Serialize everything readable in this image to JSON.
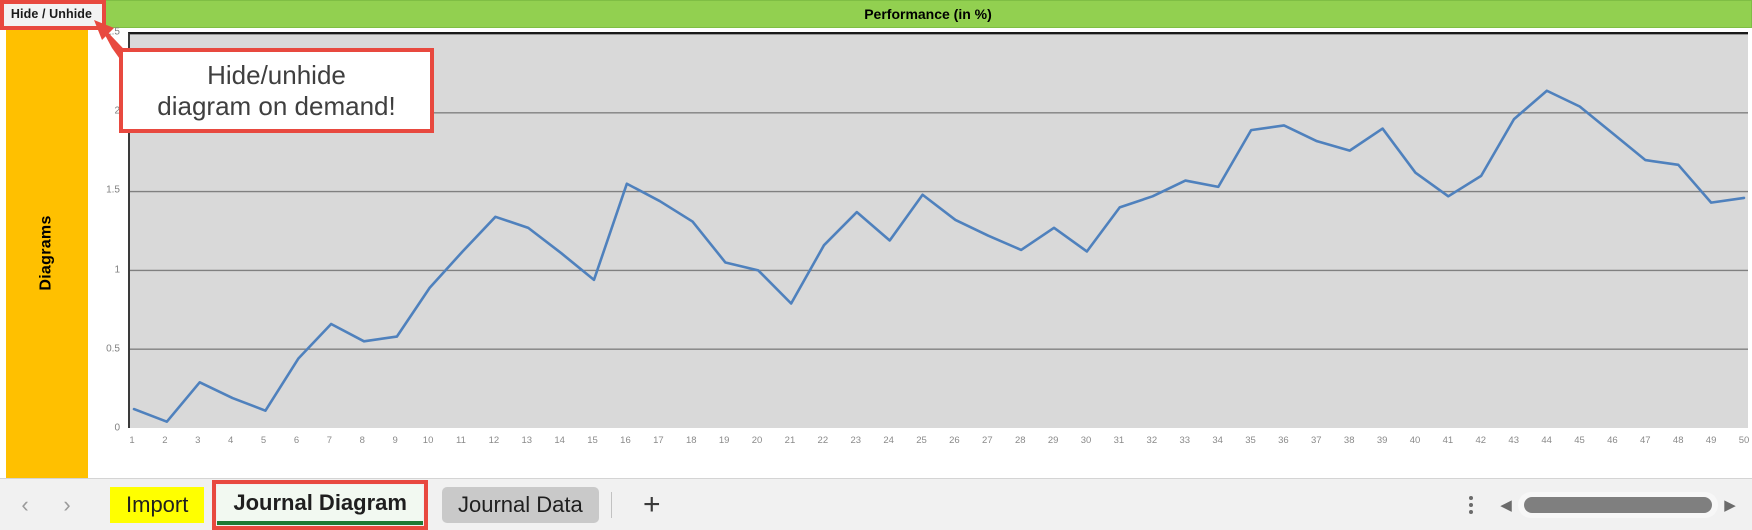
{
  "toolbar": {
    "hide_unhide_label": "Hide / Unhide"
  },
  "header": {
    "title": "Performance (in %)",
    "background_color": "#92d050"
  },
  "sidebar": {
    "label": "Diagrams",
    "background_color": "#ffc000"
  },
  "callout": {
    "line1": "Hide/unhide",
    "line2": "diagram on demand!",
    "border_color": "#e8493f"
  },
  "tab_bar": {
    "prev_label": "‹",
    "next_label": "›",
    "add_label": "+",
    "scroll_left_label": "◀",
    "scroll_right_label": "▶",
    "tabs": [
      {
        "label": "Import",
        "state": "highlighted",
        "color": "#ffff00"
      },
      {
        "label": "Journal Diagram",
        "state": "active",
        "color": "#1e7a34"
      },
      {
        "label": "Journal Data",
        "state": "inactive",
        "color": "#c9c9c9"
      }
    ]
  },
  "chart_data": {
    "type": "line",
    "title": "Performance (in %)",
    "xlabel": "",
    "ylabel": "",
    "grid": true,
    "legend": false,
    "line_color": "#4f81bd",
    "plot_background": "#d9d9d9",
    "xlim": [
      1,
      50
    ],
    "ylim": [
      0,
      2.5
    ],
    "yticks": [
      "0",
      "0.5",
      "1",
      "1.5",
      "2",
      "2.5"
    ],
    "ytick_values": [
      0,
      0.5,
      1,
      1.5,
      2,
      2.5
    ],
    "categories": [
      1,
      2,
      3,
      4,
      5,
      6,
      7,
      8,
      9,
      10,
      11,
      12,
      13,
      14,
      15,
      16,
      17,
      18,
      19,
      20,
      21,
      22,
      23,
      24,
      25,
      26,
      27,
      28,
      29,
      30,
      31,
      32,
      33,
      34,
      35,
      36,
      37,
      38,
      39,
      40,
      41,
      42,
      43,
      44,
      45,
      46,
      47,
      48,
      49,
      50
    ],
    "series": [
      {
        "name": "Performance",
        "values": [
          0.12,
          0.04,
          0.29,
          0.19,
          0.11,
          0.44,
          0.66,
          0.55,
          0.58,
          0.89,
          1.12,
          1.34,
          1.27,
          1.11,
          0.94,
          1.55,
          1.44,
          1.31,
          1.05,
          1.0,
          0.79,
          1.16,
          1.37,
          1.19,
          1.48,
          1.32,
          1.22,
          1.13,
          1.27,
          1.12,
          1.4,
          1.47,
          1.57,
          1.53,
          1.89,
          1.92,
          1.82,
          1.76,
          1.9,
          1.62,
          1.47,
          1.6,
          1.96,
          2.14,
          2.04,
          1.87,
          1.7,
          1.67,
          1.43,
          1.46
        ]
      }
    ]
  }
}
